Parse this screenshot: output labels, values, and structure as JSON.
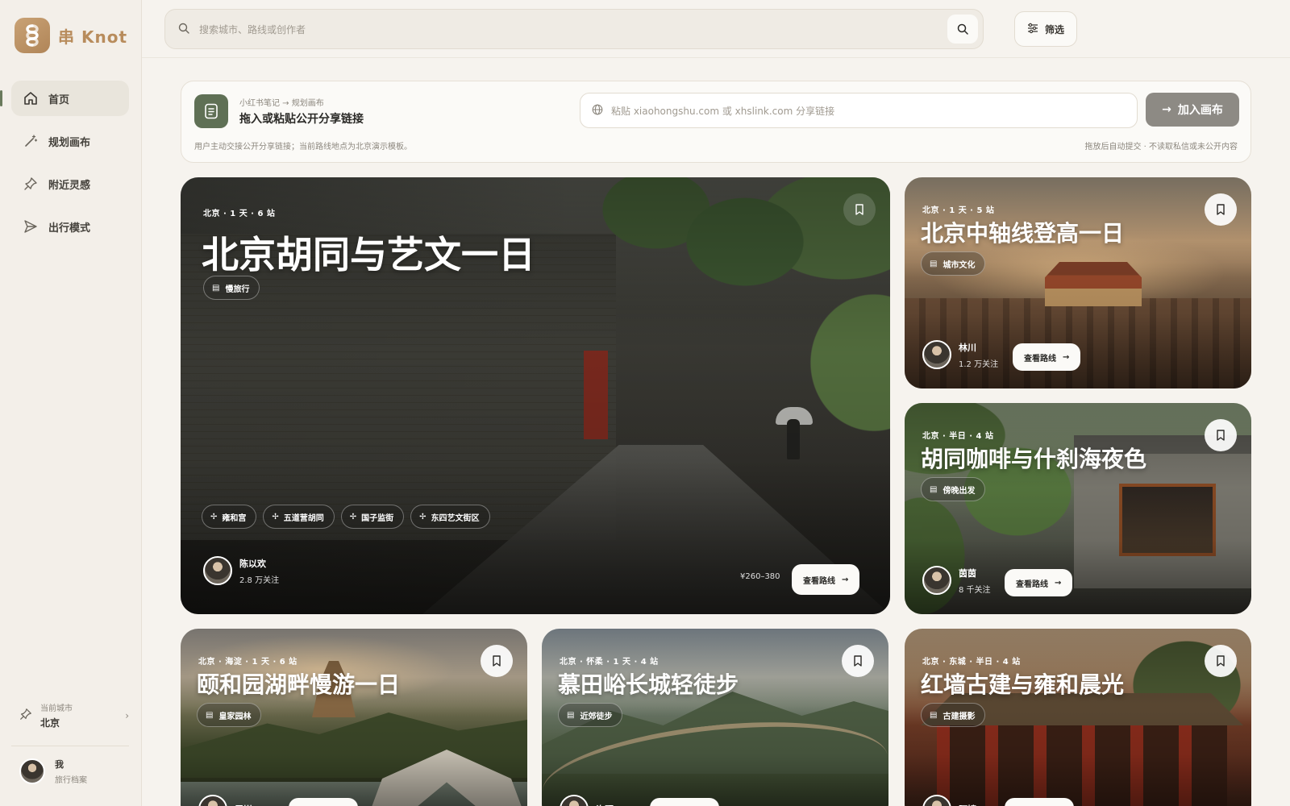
{
  "brand": {
    "glyph": "串",
    "name": "Knot",
    "accent": "#b88c5c"
  },
  "sidebar": {
    "items": [
      {
        "label": "首页",
        "icon": "home-icon",
        "active": true
      },
      {
        "label": "规划画布",
        "icon": "magic-wand-icon",
        "active": false
      },
      {
        "label": "附近灵感",
        "icon": "pin-icon",
        "active": false
      },
      {
        "label": "出行模式",
        "icon": "send-icon",
        "active": false
      }
    ],
    "city": {
      "label": "当前城市",
      "value": "北京"
    },
    "me": {
      "name": "我",
      "sub": "旅行档案"
    }
  },
  "topbar": {
    "search_placeholder": "搜索城市、路线或创作者",
    "filter_label": "筛选"
  },
  "import": {
    "crumb": "小红书笔记 → 规划画布",
    "title": "拖入或粘贴公开分享链接",
    "input_placeholder": "粘贴 xiaohongshu.com 或 xhslink.com 分享链接",
    "button_label": "加入画布",
    "note": "用户主动交接公开分享链接；当前路线地点为北京演示模板。",
    "hint": "拖放后自动提交 · 不读取私信或未公开内容"
  },
  "hero": {
    "meta": "北京 · 1 天 · 6 站",
    "title": "北京胡同与艺文一日",
    "chip": "慢旅行",
    "tags": [
      "雍和宫",
      "五道营胡同",
      "国子监街",
      "东四艺文街区"
    ],
    "author": {
      "name": "陈以欢",
      "fans": "2.8 万关注"
    },
    "price": "¥260–380",
    "view_label": "查看路线"
  },
  "cards": [
    {
      "meta": "北京 · 1 天 · 5 站",
      "title": "北京中轴线登高一日",
      "chip": "城市文化",
      "author": {
        "name": "林川",
        "fans": "1.2 万关注"
      },
      "view_label": "查看路线"
    },
    {
      "meta": "北京 · 半日 · 4 站",
      "title": "胡同咖啡与什刹海夜色",
      "chip": "傍晚出发",
      "author": {
        "name": "茵茵",
        "fans": "8 千关注"
      },
      "view_label": "查看路线"
    },
    {
      "meta": "北京 · 海淀 · 1 天 · 6 站",
      "title": "颐和园湖畔慢游一日",
      "chip": "皇家园林",
      "author": {
        "name": "周岚"
      }
    },
    {
      "meta": "北京 · 怀柔 · 1 天 · 4 站",
      "title": "慕田峪长城轻徒步",
      "chip": "近郊徒步",
      "author": {
        "name": "许野"
      }
    },
    {
      "meta": "北京 · 东城 · 半日 · 4 站",
      "title": "红墙古建与雍和晨光",
      "chip": "古建摄影",
      "author": {
        "name": "阿婧"
      }
    }
  ]
}
